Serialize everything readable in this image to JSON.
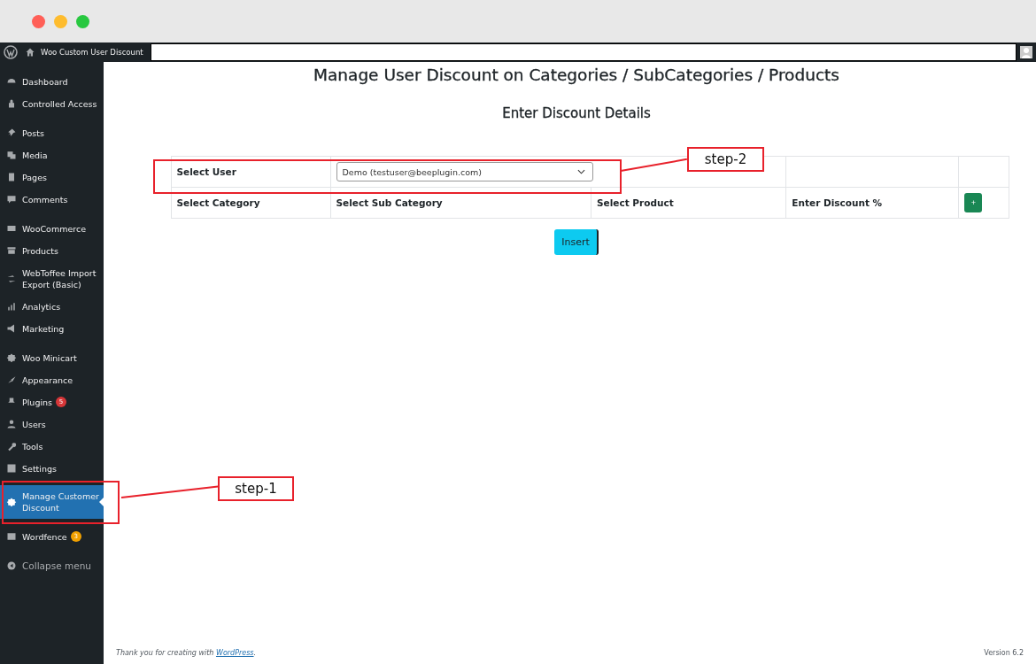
{
  "admin_bar": {
    "site_title": "Woo Custom User Discount"
  },
  "sidebar": {
    "groups": [
      [
        {
          "label": "Dashboard",
          "selected": false
        },
        {
          "label": "Controlled Access",
          "selected": false
        }
      ],
      [
        {
          "label": "Posts",
          "selected": false
        },
        {
          "label": "Media",
          "selected": false
        },
        {
          "label": "Pages",
          "selected": false
        },
        {
          "label": "Comments",
          "selected": false
        }
      ],
      [
        {
          "label": "WooCommerce",
          "selected": false
        },
        {
          "label": "Products",
          "selected": false
        },
        {
          "label": "WebToffee Import Export (Basic)",
          "selected": false
        },
        {
          "label": "Analytics",
          "selected": false
        },
        {
          "label": "Marketing",
          "selected": false
        }
      ],
      [
        {
          "label": "Woo Minicart",
          "selected": false
        },
        {
          "label": "Appearance",
          "selected": false
        },
        {
          "label": "Plugins",
          "selected": false,
          "badge": "5",
          "color": "#d63638"
        },
        {
          "label": "Users",
          "selected": false
        },
        {
          "label": "Tools",
          "selected": false
        },
        {
          "label": "Settings",
          "selected": false
        },
        {
          "label": "Manage Customer Discount",
          "selected": true
        },
        {
          "label": "Wordfence",
          "selected": false,
          "badge": "3",
          "color": "#f0a000"
        }
      ]
    ],
    "collapse": "Collapse menu"
  },
  "page": {
    "title": "Manage User Discount on Categories / SubCategories / Products",
    "subtitle": "Enter Discount Details",
    "user_row": {
      "label": "Select User",
      "value": "Demo (testuser@beeplugin.com)"
    },
    "columns": [
      "Select Category",
      "Select Sub Category",
      "Select Product",
      "Enter Discount %"
    ],
    "add_button": "+",
    "insert_button": "Insert"
  },
  "annotations": [
    {
      "label": "step-1"
    },
    {
      "label": "step-2"
    }
  ],
  "footer": {
    "text": "Thank you for creating with ",
    "link": "WordPress",
    "after": ".",
    "version": "Version 6.2"
  }
}
